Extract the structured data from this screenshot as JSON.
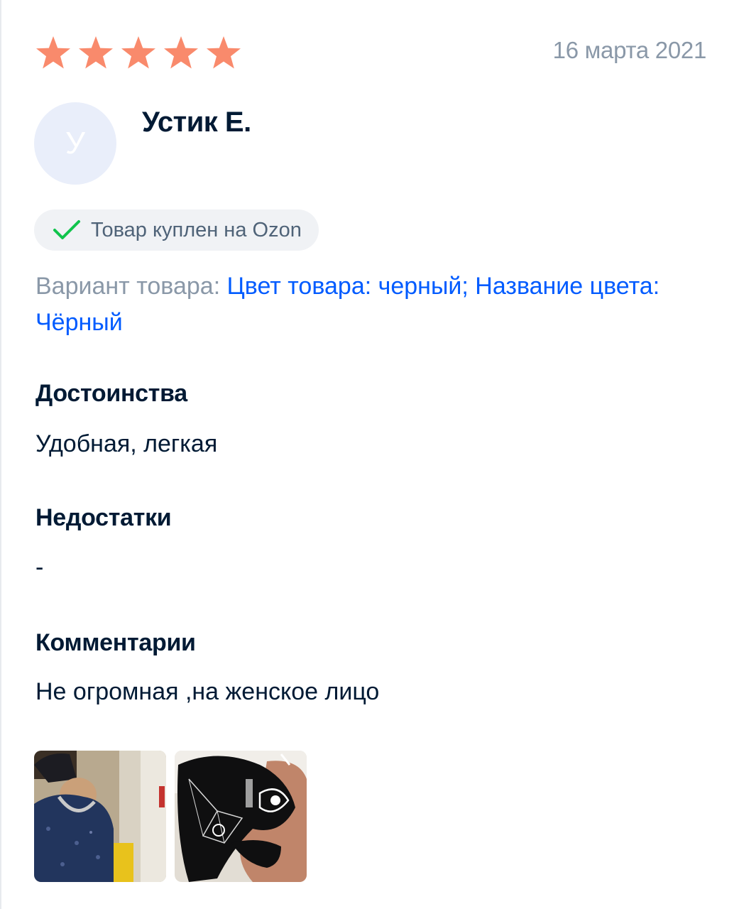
{
  "review": {
    "rating": 5,
    "rating_max": 5,
    "star_color": "#f98a6c",
    "date": "16 марта 2021",
    "author": {
      "name": "Устик Е.",
      "avatar_initial": "У"
    },
    "badge": {
      "icon": "check-icon",
      "text": "Товар куплен на Ozon"
    },
    "variant": {
      "label": "Вариант товара:",
      "value": "Цвет товара: черный; Название цвета: Чёрный"
    },
    "sections": {
      "pros": {
        "title": "Достоинства",
        "text": "Удобная, легкая"
      },
      "cons": {
        "title": "Недостатки",
        "text": "-"
      },
      "comments": {
        "title": "Комментарии",
        "text": "Не огромная ,на женское лицо"
      }
    },
    "photos": [
      {
        "name": "photo-person-in-mask"
      },
      {
        "name": "photo-black-mask"
      }
    ]
  }
}
